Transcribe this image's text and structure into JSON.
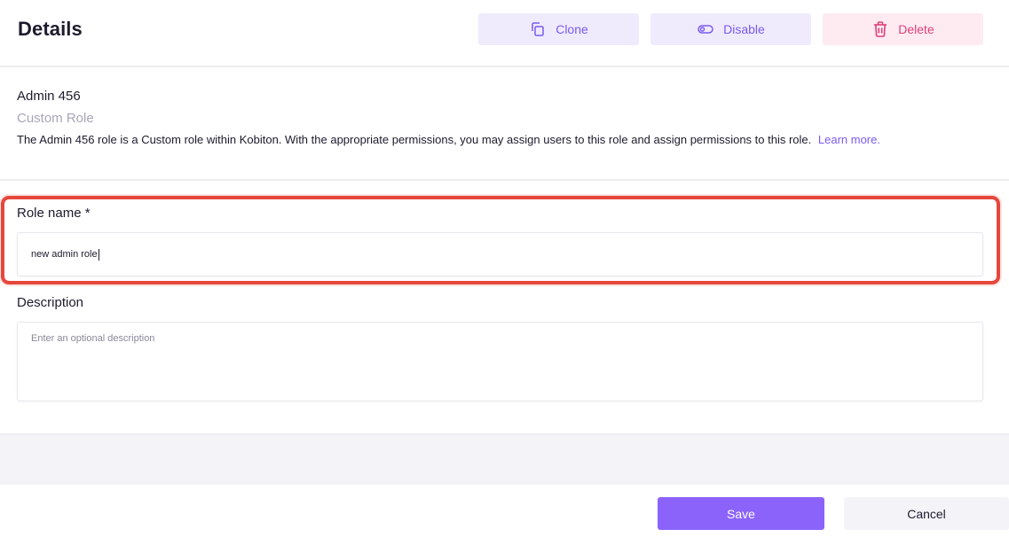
{
  "header": {
    "title": "Details",
    "clone_label": "Clone",
    "disable_label": "Disable",
    "delete_label": "Delete"
  },
  "role": {
    "name": "Admin 456",
    "type": "Custom Role",
    "description": "The Admin 456 role is a Custom role within Kobiton. With the appropriate permissions, you may assign users to this role and assign permissions to this role.",
    "learn_more": "Learn more."
  },
  "form": {
    "role_name_label": "Role name *",
    "role_name_value": "new admin role",
    "description_label": "Description",
    "description_placeholder": "Enter an optional description"
  },
  "footer": {
    "save_label": "Save",
    "cancel_label": "Cancel"
  },
  "colors": {
    "accent": "#8b63fb",
    "danger": "#e0407a",
    "highlight": "#e5473c"
  },
  "icons": {
    "clone": "copy-icon",
    "disable": "toggle-icon",
    "delete": "trash-icon"
  }
}
